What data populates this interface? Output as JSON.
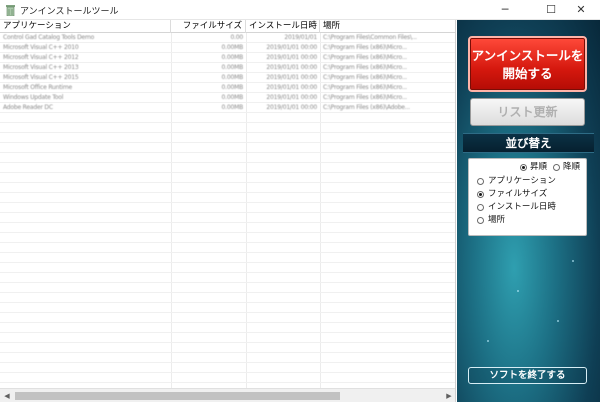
{
  "window": {
    "title": "アンインストールツール",
    "min_glyph": "─",
    "max_glyph": "☐",
    "close_glyph": "✕",
    "icon": "trash-can-icon"
  },
  "list": {
    "columns": [
      "アプリケーション",
      "ファイルサイズ",
      "インストール日時",
      "場所"
    ],
    "rows": [
      [
        "Control Gad Catalog Tools Demo",
        "0.00",
        "2019/01/01",
        "C:\\Program Files\\Common Files\\..."
      ],
      [
        "Microsoft Visual C++ 2010",
        "0.00MB",
        "2019/01/01 00:00",
        "C:\\Program Files (x86)\\Micro..."
      ],
      [
        "Microsoft Visual C++ 2012",
        "0.00MB",
        "2019/01/01 00:00",
        "C:\\Program Files (x86)\\Micro..."
      ],
      [
        "Microsoft Visual C++ 2013",
        "0.00MB",
        "2019/01/01 00:00",
        "C:\\Program Files (x86)\\Micro..."
      ],
      [
        "Microsoft Visual C++ 2015",
        "0.00MB",
        "2019/01/01 00:00",
        "C:\\Program Files (x86)\\Micro..."
      ],
      [
        "Microsoft Office Runtime",
        "0.00MB",
        "2019/01/01 00:00",
        "C:\\Program Files (x86)\\Micro..."
      ],
      [
        "Windows Update Tool",
        "0.00MB",
        "2019/01/01 00:00",
        "C:\\Program Files (x86)\\Micro..."
      ],
      [
        "Adobe Reader DC",
        "0.00MB",
        "2019/01/01 00:00",
        "C:\\Program Files (x86)\\Adobe..."
      ]
    ]
  },
  "scrollbar": {
    "left_glyph": "◀",
    "right_glyph": "▶"
  },
  "panel": {
    "uninstall_label_1": "アンインストールを",
    "uninstall_label_2": "開始する",
    "refresh_label": "リスト更新",
    "sort_title": "並び替え",
    "order_asc": "昇順",
    "order_desc": "降順",
    "order_selected": "asc",
    "sort_options": [
      "アプリケーション",
      "ファイルサイズ",
      "インストール日時",
      "場所"
    ],
    "sort_selected": "ファイルサイズ",
    "exit_label": "ソフトを終了する",
    "accent_red": "#d5180e",
    "panel_teal": "#1c6f84"
  }
}
